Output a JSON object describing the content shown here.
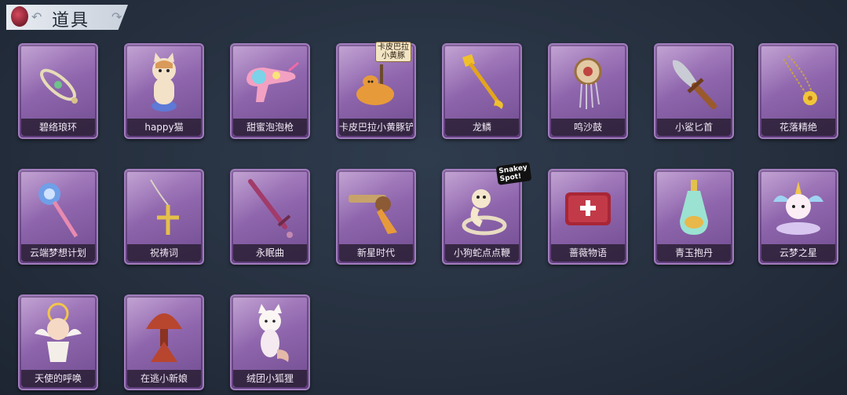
{
  "header": {
    "title": "道具",
    "back_icon": "↶",
    "forward_icon": "↷"
  },
  "items": [
    {
      "label": "碧络琅环",
      "icon": "jade-ring-icon"
    },
    {
      "label": "happy猫",
      "icon": "cat-icon"
    },
    {
      "label": "甜蜜泡泡枪",
      "icon": "bubble-gun-icon"
    },
    {
      "label": "卡皮巴拉小黄豚铲",
      "icon": "capybara-shovel-icon",
      "badge": "卡皮巴拉\n小黄豚"
    },
    {
      "label": "龙鳞",
      "icon": "dragon-shovel-icon"
    },
    {
      "label": "鸣沙鼓",
      "icon": "sand-drum-icon"
    },
    {
      "label": "小鲨匕首",
      "icon": "shark-dagger-icon"
    },
    {
      "label": "花落精绝",
      "icon": "flower-necklace-icon"
    },
    {
      "label": "云端梦想计划",
      "icon": "cloud-scepter-icon"
    },
    {
      "label": "祝祷词",
      "icon": "cross-pendant-icon"
    },
    {
      "label": "永眠曲",
      "icon": "sword-icon"
    },
    {
      "label": "新星时代",
      "icon": "revolver-icon"
    },
    {
      "label": "小狗蛇点点鞭",
      "icon": "snake-whip-icon",
      "badge": "Snakey Spot!"
    },
    {
      "label": "蔷薇物语",
      "icon": "medkit-icon"
    },
    {
      "label": "青玉抱丹",
      "icon": "potion-bottle-icon"
    },
    {
      "label": "云梦之星",
      "icon": "unicorn-icon"
    },
    {
      "label": "天使的呼唤",
      "icon": "angel-doll-icon"
    },
    {
      "label": "在逃小新娘",
      "icon": "bride-doll-icon"
    },
    {
      "label": "绒团小狐狸",
      "icon": "fox-plush-icon"
    }
  ]
}
